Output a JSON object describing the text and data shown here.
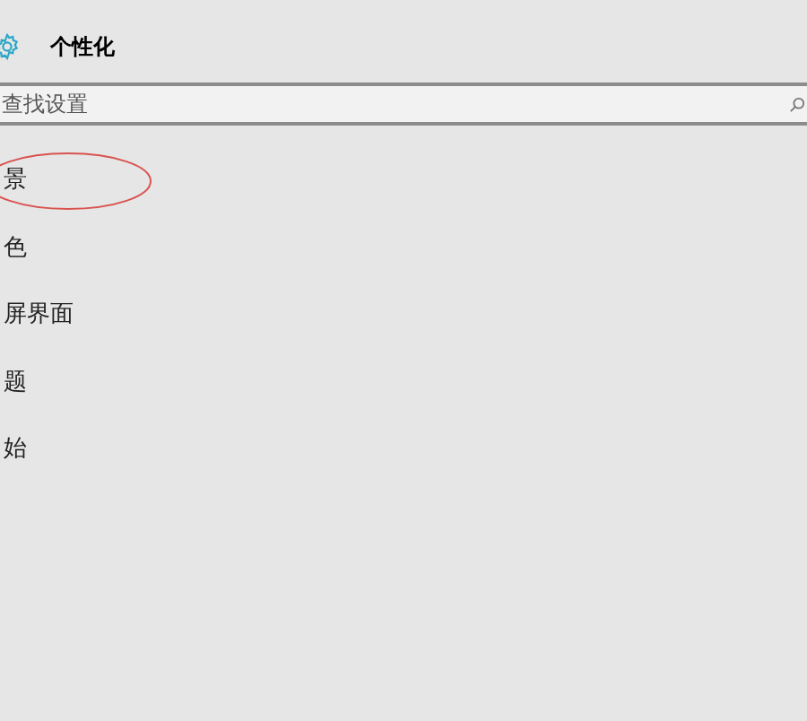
{
  "header": {
    "title": "个性化"
  },
  "search": {
    "placeholder": "查找设置"
  },
  "nav_items": [
    {
      "label": "景",
      "circled": true
    },
    {
      "label": "色",
      "circled": false
    },
    {
      "label": "屏界面",
      "circled": false
    },
    {
      "label": "题",
      "circled": false
    },
    {
      "label": "始",
      "circled": false
    }
  ]
}
